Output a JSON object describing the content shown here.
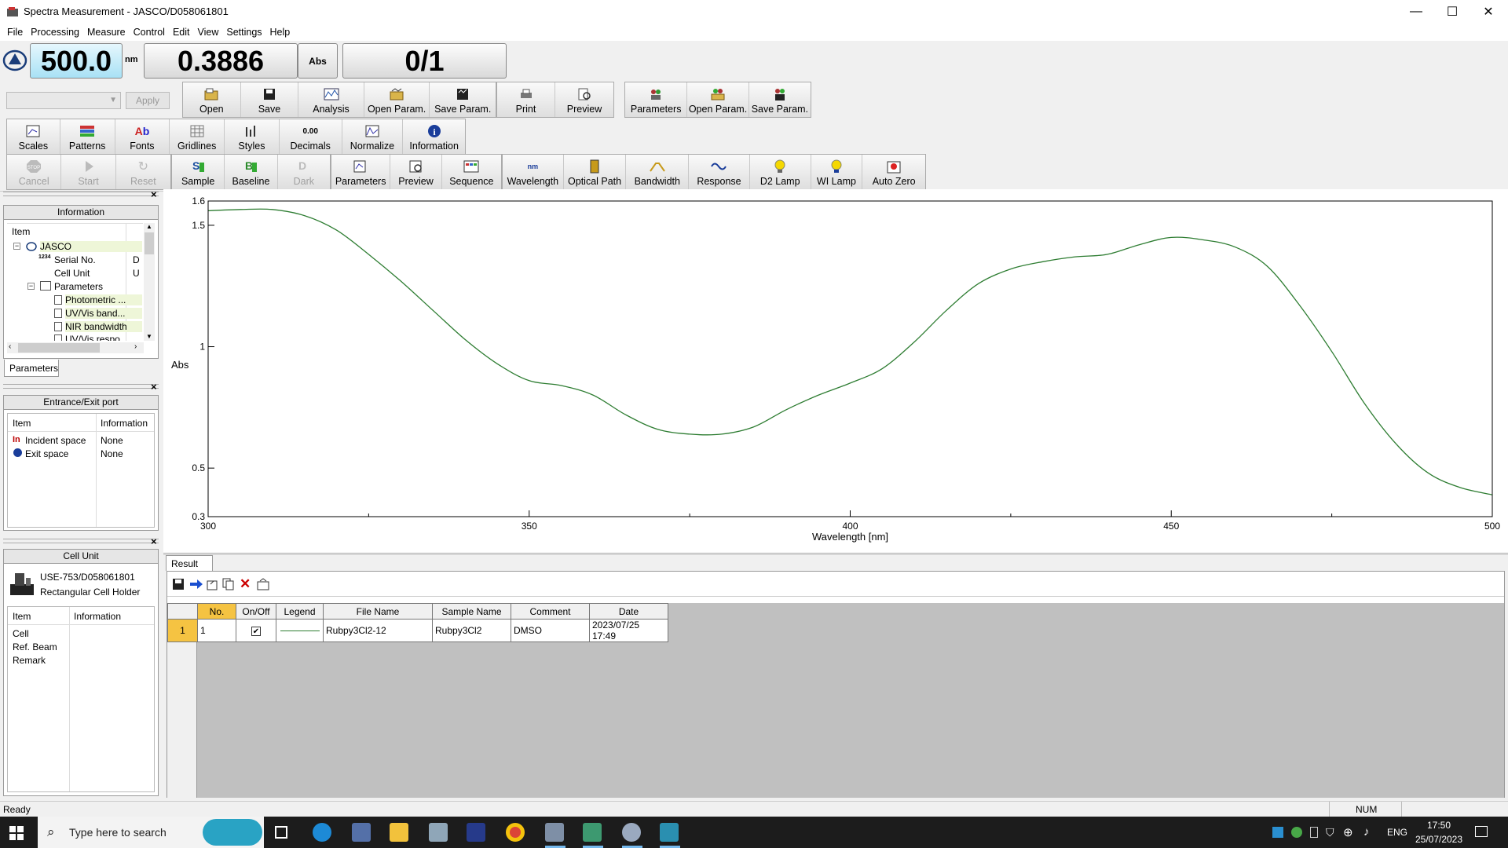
{
  "window": {
    "title": "Spectra Measurement - JASCO/D058061801",
    "controls": [
      "—",
      "☐",
      "✕"
    ]
  },
  "menu": [
    "File",
    "Processing",
    "Measure",
    "Control",
    "Edit",
    "View",
    "Settings",
    "Help"
  ],
  "readout": {
    "wavelength": "500.0",
    "wavelength_unit": "nm",
    "value": "0.3886",
    "value_unit": "Abs",
    "count": "0/1"
  },
  "toolbar_file": {
    "apply_label": "Apply",
    "buttons": [
      "Open",
      "Save",
      "Analysis",
      "Open Param.",
      "Save Param.",
      "Print",
      "Preview",
      "Parameters",
      "Open Param.",
      "Save Param."
    ]
  },
  "toolbar_view": {
    "buttons": [
      "Scales",
      "Patterns",
      "Fonts",
      "Gridlines",
      "Styles",
      "Decimals",
      "Normalize",
      "Information"
    ]
  },
  "toolbar_measure": {
    "buttons": [
      "Cancel",
      "Start",
      "Reset",
      "Sample",
      "Baseline",
      "Dark",
      "Parameters",
      "Preview",
      "Sequence",
      "Wavelength",
      "Optical Path",
      "Bandwidth",
      "Response",
      "D2 Lamp",
      "WI Lamp",
      "Auto Zero"
    ],
    "stop_label": "STOP"
  },
  "info_panel": {
    "title": "Information",
    "header": "Item",
    "tree": [
      {
        "label": "JASCO",
        "value": ""
      },
      {
        "label": "Serial No.",
        "value": "D"
      },
      {
        "label": "Cell Unit",
        "value": "U"
      },
      {
        "label": "Parameters",
        "value": ""
      },
      {
        "label": "Photometric ...",
        "value": ""
      },
      {
        "label": "UV/Vis band...",
        "value": ""
      },
      {
        "label": "NIR bandwidth",
        "value": ""
      },
      {
        "label": "UV/Vis respo...",
        "value": ""
      }
    ],
    "serial_icon_text": "1234",
    "tab": "Parameters"
  },
  "port_panel": {
    "title": "Entrance/Exit port",
    "headers": [
      "Item",
      "Information"
    ],
    "rows": [
      {
        "item": "Incident space",
        "info": "None"
      },
      {
        "item": "Exit space",
        "info": "None"
      }
    ]
  },
  "cell_panel": {
    "title": "Cell Unit",
    "model": "USE-753/D058061801",
    "holder": "Rectangular Cell Holder",
    "headers": [
      "Item",
      "Information"
    ],
    "rows": [
      "Cell",
      "Ref. Beam",
      "Remark"
    ]
  },
  "chart_data": {
    "type": "line",
    "xlabel": "Wavelength [nm]",
    "ylabel": "Abs",
    "xlim": [
      300,
      500
    ],
    "ylim": [
      0.3,
      1.6
    ],
    "x_ticks": [
      300,
      350,
      400,
      450,
      500
    ],
    "y_ticks": [
      0.3,
      0.5,
      1,
      1.5,
      1.6
    ],
    "y_tick_labels": [
      "0.3",
      "0.5",
      "1",
      "1.5",
      "1.6"
    ],
    "color": "#2e7d32",
    "series": [
      {
        "name": "",
        "x": [
          300,
          305,
          310,
          315,
          320,
          325,
          330,
          335,
          340,
          345,
          350,
          355,
          360,
          365,
          370,
          375,
          380,
          385,
          390,
          395,
          400,
          405,
          410,
          415,
          420,
          425,
          430,
          435,
          440,
          445,
          450,
          455,
          460,
          465,
          470,
          475,
          480,
          485,
          490,
          495,
          500
        ],
        "y": [
          1.56,
          1.565,
          1.565,
          1.54,
          1.48,
          1.38,
          1.27,
          1.15,
          1.03,
          0.93,
          0.86,
          0.84,
          0.8,
          0.72,
          0.66,
          0.64,
          0.64,
          0.67,
          0.74,
          0.8,
          0.85,
          0.91,
          1.02,
          1.15,
          1.26,
          1.32,
          1.35,
          1.37,
          1.38,
          1.42,
          1.45,
          1.44,
          1.41,
          1.33,
          1.17,
          0.98,
          0.77,
          0.6,
          0.48,
          0.42,
          0.39
        ]
      }
    ]
  },
  "result_list": {
    "tab": "Result List",
    "headers": [
      "No.",
      "On/Off",
      "Legend",
      "File Name",
      "Sample Name",
      "Comment",
      "Date"
    ],
    "rows": [
      {
        "index": "1",
        "no": "1",
        "onoff": "✔",
        "file": "Rubpy3Cl2-12",
        "sample": "Rubpy3Cl2",
        "comment": "DMSO",
        "date": "2023/07/25 17:49"
      }
    ]
  },
  "status": {
    "text": "Ready",
    "num": "NUM"
  },
  "taskbar": {
    "search_placeholder": "Type here to search",
    "language": "ENG",
    "time": "17:50",
    "date": "25/07/2023"
  }
}
